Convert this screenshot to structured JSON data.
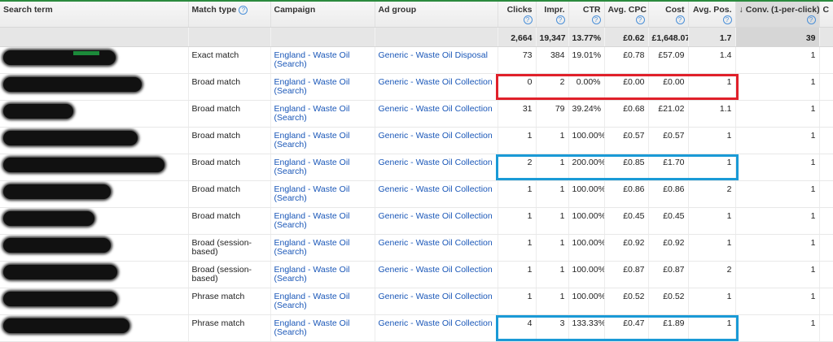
{
  "columns": [
    {
      "label": "Search term",
      "help": false
    },
    {
      "label": "Match type",
      "help": true
    },
    {
      "label": "Campaign",
      "help": false
    },
    {
      "label": "Ad group",
      "help": false
    },
    {
      "label": "Clicks",
      "help": true
    },
    {
      "label": "Impr.",
      "help": true
    },
    {
      "label": "CTR",
      "help": true
    },
    {
      "label": "Avg. CPC",
      "help": true
    },
    {
      "label": "Cost",
      "help": true
    },
    {
      "label": "Avg. Pos.",
      "help": true
    },
    {
      "label": "Conv. (1-per-click)",
      "help": true,
      "sorted": true,
      "sort_icon": "↓"
    },
    {
      "label": "C",
      "help": false
    }
  ],
  "help_icon": "?",
  "totals": [
    "",
    "",
    "",
    "",
    "2,664",
    "19,347",
    "13.77%",
    "£0.62",
    "£1,648.07",
    "1.7",
    "39"
  ],
  "rows": [
    {
      "blob": 138,
      "match": "Exact match",
      "campaign": "England - Waste Oil (Search)",
      "adgroup": "Generic - Waste Oil Disposal",
      "clicks": "73",
      "impr": "384",
      "ctr": "19.01%",
      "cpc": "£0.78",
      "cost": "£57.09",
      "pos": "1.4",
      "conv": "1"
    },
    {
      "blob": 170,
      "match": "Broad match",
      "campaign": "England - Waste Oil (Search)",
      "adgroup": "Generic - Waste Oil Collection",
      "clicks": "0",
      "impr": "2",
      "ctr": "0.00%",
      "cpc": "£0.00",
      "cost": "£0.00",
      "pos": "1",
      "conv": "1"
    },
    {
      "blob": 86,
      "match": "Broad match",
      "campaign": "England - Waste Oil (Search)",
      "adgroup": "Generic - Waste Oil Collection",
      "clicks": "31",
      "impr": "79",
      "ctr": "39.24%",
      "cpc": "£0.68",
      "cost": "£21.02",
      "pos": "1.1",
      "conv": "1"
    },
    {
      "blob": 165,
      "match": "Broad match",
      "campaign": "England - Waste Oil (Search)",
      "adgroup": "Generic - Waste Oil Collection",
      "clicks": "1",
      "impr": "1",
      "ctr": "100.00%",
      "cpc": "£0.57",
      "cost": "£0.57",
      "pos": "1",
      "conv": "1"
    },
    {
      "blob": 198,
      "match": "Broad match",
      "campaign": "England - Waste Oil (Search)",
      "adgroup": "Generic - Waste Oil Collection",
      "clicks": "2",
      "impr": "1",
      "ctr": "200.00%",
      "cpc": "£0.85",
      "cost": "£1.70",
      "pos": "1",
      "conv": "1"
    },
    {
      "blob": 132,
      "match": "Broad match",
      "campaign": "England - Waste Oil (Search)",
      "adgroup": "Generic - Waste Oil Collection",
      "clicks": "1",
      "impr": "1",
      "ctr": "100.00%",
      "cpc": "£0.86",
      "cost": "£0.86",
      "pos": "2",
      "conv": "1"
    },
    {
      "blob": 112,
      "match": "Broad match",
      "campaign": "England - Waste Oil (Search)",
      "adgroup": "Generic - Waste Oil Collection",
      "clicks": "1",
      "impr": "1",
      "ctr": "100.00%",
      "cpc": "£0.45",
      "cost": "£0.45",
      "pos": "1",
      "conv": "1"
    },
    {
      "blob": 132,
      "match": "Broad (session-based)",
      "campaign": "England - Waste Oil (Search)",
      "adgroup": "Generic - Waste Oil Collection",
      "clicks": "1",
      "impr": "1",
      "ctr": "100.00%",
      "cpc": "£0.92",
      "cost": "£0.92",
      "pos": "1",
      "conv": "1"
    },
    {
      "blob": 140,
      "match": "Broad (session-based)",
      "campaign": "England - Waste Oil (Search)",
      "adgroup": "Generic - Waste Oil Collection",
      "clicks": "1",
      "impr": "1",
      "ctr": "100.00%",
      "cpc": "£0.87",
      "cost": "£0.87",
      "pos": "2",
      "conv": "1"
    },
    {
      "blob": 140,
      "match": "Phrase match",
      "campaign": "England - Waste Oil (Search)",
      "adgroup": "Generic - Waste Oil Collection",
      "clicks": "1",
      "impr": "1",
      "ctr": "100.00%",
      "cpc": "£0.52",
      "cost": "£0.52",
      "pos": "1",
      "conv": "1"
    },
    {
      "blob": 155,
      "match": "Phrase match",
      "campaign": "England - Waste Oil (Search)",
      "adgroup": "Generic - Waste Oil Collection",
      "clicks": "4",
      "impr": "3",
      "ctr": "133.33%",
      "cpc": "£0.47",
      "cost": "£1.89",
      "pos": "1",
      "conv": "1"
    }
  ],
  "highlights": [
    {
      "color": "red",
      "row": 1
    },
    {
      "color": "blue",
      "row": 4
    },
    {
      "color": "blue",
      "row": 10
    }
  ]
}
